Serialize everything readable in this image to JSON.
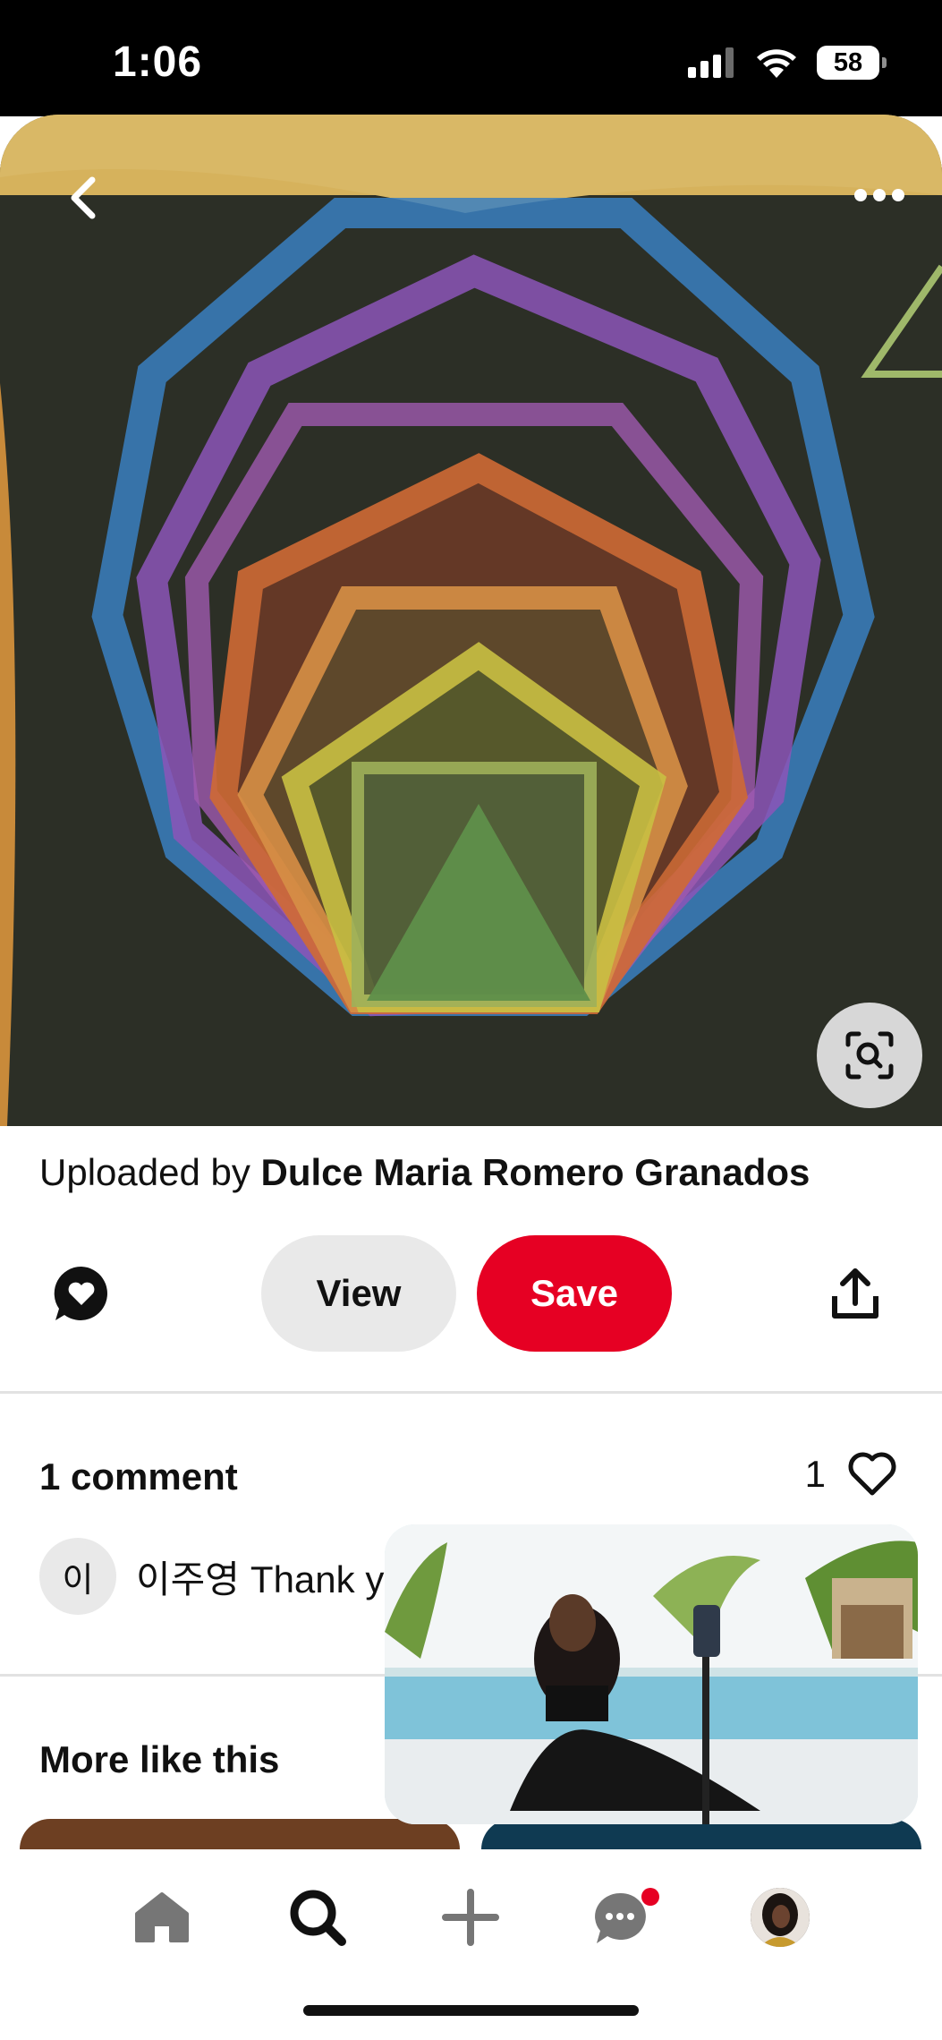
{
  "status_bar": {
    "time": "1:06",
    "battery": "58"
  },
  "pin": {
    "uploaded_prefix": "Uploaded by",
    "uploader": "Dulce Maria Romero Granados"
  },
  "actions": {
    "view_label": "View",
    "save_label": "Save"
  },
  "comments": {
    "title": "1 comment",
    "like_count": "1",
    "items": [
      {
        "avatar_initial": "이",
        "author": "이주영",
        "text": "Thank y"
      }
    ]
  },
  "more": {
    "title": "More like this"
  },
  "colors": {
    "save_red": "#e60023",
    "view_gray": "#e9e9e9",
    "notification_dot": "#e60023"
  },
  "icons": {
    "back": "chevron-left-icon",
    "more": "ellipsis-icon",
    "lens": "visual-search-icon",
    "comment": "comment-heart-icon",
    "share": "share-icon",
    "like": "heart-outline-icon",
    "nav": [
      "home-icon",
      "search-icon",
      "plus-icon",
      "messages-icon",
      "profile-avatar"
    ]
  }
}
